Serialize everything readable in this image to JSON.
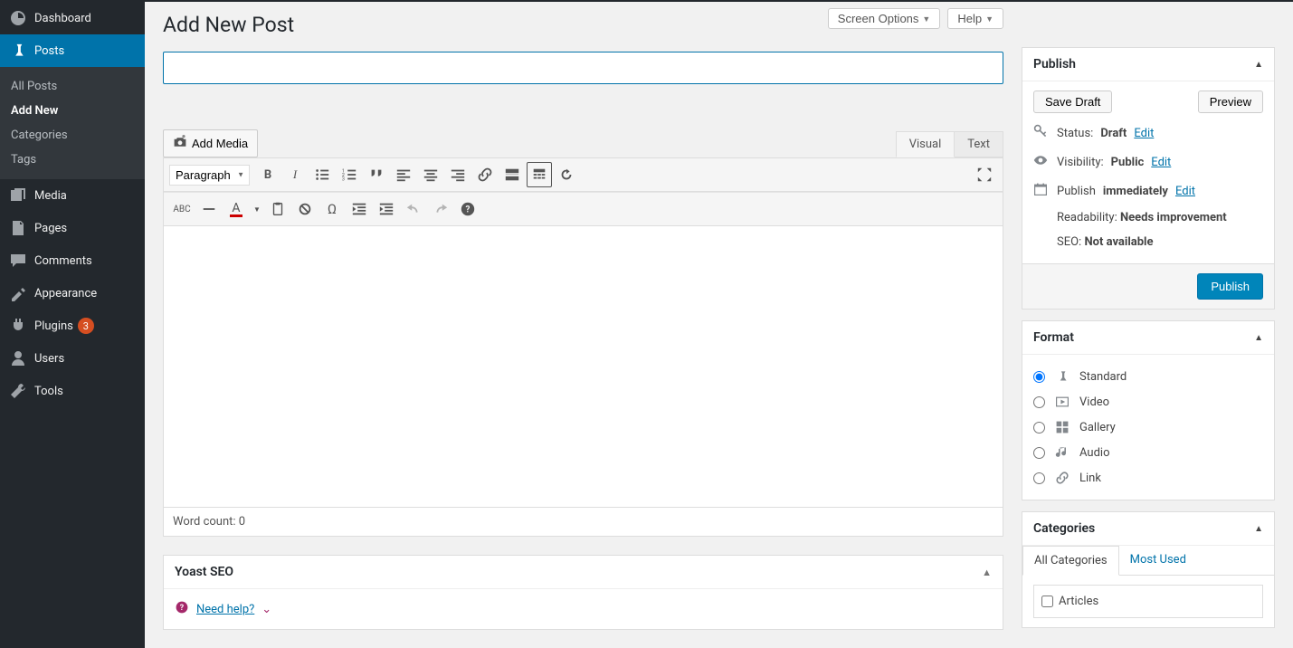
{
  "top_actions": {
    "screen_options": "Screen Options",
    "help": "Help"
  },
  "sidebar": {
    "dashboard": "Dashboard",
    "posts": "Posts",
    "submenu": {
      "all_posts": "All Posts",
      "add_new": "Add New",
      "categories": "Categories",
      "tags": "Tags"
    },
    "media": "Media",
    "pages": "Pages",
    "comments": "Comments",
    "appearance": "Appearance",
    "plugins": "Plugins",
    "plugins_badge": "3",
    "users": "Users",
    "tools": "Tools"
  },
  "page": {
    "title": "Add New Post"
  },
  "title_input": {
    "value": ""
  },
  "media_button": "Add Media",
  "editor_tabs": {
    "visual": "Visual",
    "text": "Text"
  },
  "format_dropdown": "Paragraph",
  "word_count_label": "Word count: 0",
  "yoast": {
    "title": "Yoast SEO",
    "need_help": "Need help?"
  },
  "publish_panel": {
    "title": "Publish",
    "save_draft": "Save Draft",
    "preview": "Preview",
    "status_label": "Status:",
    "status_value": "Draft",
    "visibility_label": "Visibility:",
    "visibility_value": "Public",
    "publish_label": "Publish",
    "publish_value": "immediately",
    "readability_label": "Readability:",
    "readability_value": "Needs improvement",
    "seo_label": "SEO:",
    "seo_value": "Not available",
    "edit": "Edit",
    "publish_btn": "Publish"
  },
  "format_panel": {
    "title": "Format",
    "options": {
      "standard": "Standard",
      "video": "Video",
      "gallery": "Gallery",
      "audio": "Audio",
      "link": "Link"
    }
  },
  "categories_panel": {
    "title": "Categories",
    "tab_all": "All Categories",
    "tab_most": "Most Used",
    "item_articles": "Articles"
  }
}
